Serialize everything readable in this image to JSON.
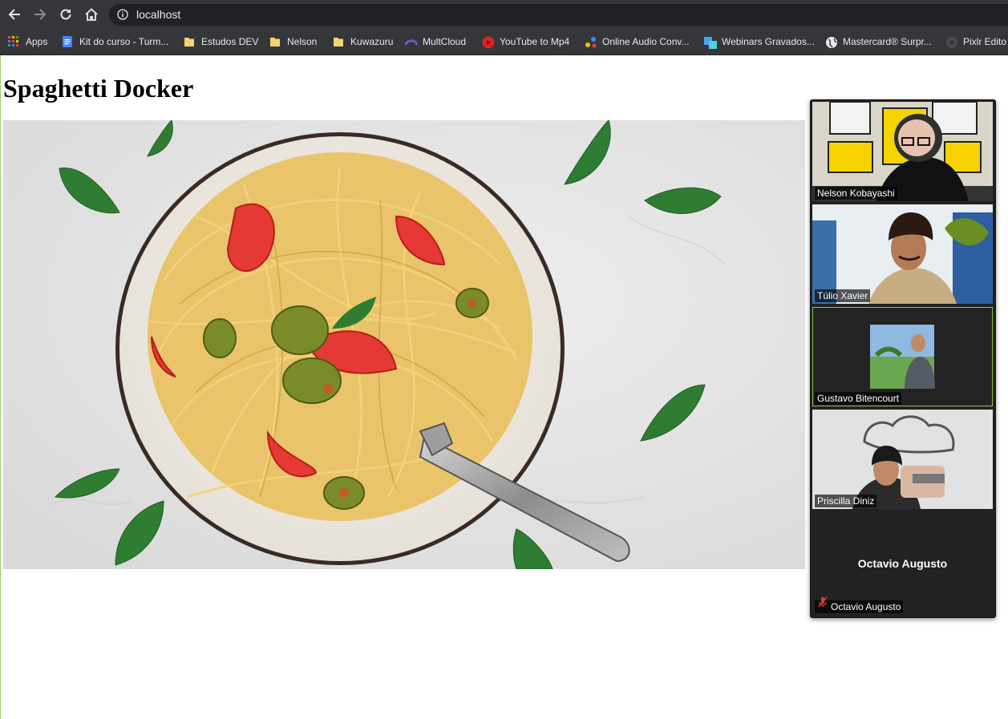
{
  "browser": {
    "url": "localhost",
    "bookmarks": [
      {
        "label": "Apps",
        "icon": "apps-grid-icon"
      },
      {
        "label": "Kit do curso - Turm...",
        "icon": "google-docs-icon"
      },
      {
        "label": "Estudos DEV",
        "icon": "folder-icon"
      },
      {
        "label": "Nelson",
        "icon": "folder-icon"
      },
      {
        "label": "Kuwazuru",
        "icon": "folder-icon"
      },
      {
        "label": "MultCloud",
        "icon": "multcloud-icon"
      },
      {
        "label": "YouTube to Mp4",
        "icon": "youtube-converter-icon"
      },
      {
        "label": "Online Audio Conv...",
        "icon": "audio-converter-icon"
      },
      {
        "label": "Webinars Gravados...",
        "icon": "webinar-icon"
      },
      {
        "label": "Mastercard® Surpr...",
        "icon": "globe-icon"
      },
      {
        "label": "Pixlr Edito",
        "icon": "pixlr-icon"
      }
    ]
  },
  "page": {
    "title": "Spaghetti Docker",
    "image_subject": "spaghetti-plate-image"
  },
  "meeting": {
    "participants": [
      {
        "name": "Nelson Kobayashi",
        "video": "on"
      },
      {
        "name": "Túlio Xavier",
        "video": "on"
      },
      {
        "name": "Gustavo Bitencourt",
        "video": "profile-picture",
        "active_speaker": true
      },
      {
        "name": "Priscilla Diniz",
        "video": "on"
      },
      {
        "name": "Octavio Augusto",
        "video": "off",
        "muted": true,
        "display_name": "Octavio Augusto"
      }
    ]
  },
  "colors": {
    "browser_chrome": "#35363a",
    "omnibox": "#202124",
    "active_speaker_border": "#8bc34a",
    "muted_icon": "#e53935"
  }
}
